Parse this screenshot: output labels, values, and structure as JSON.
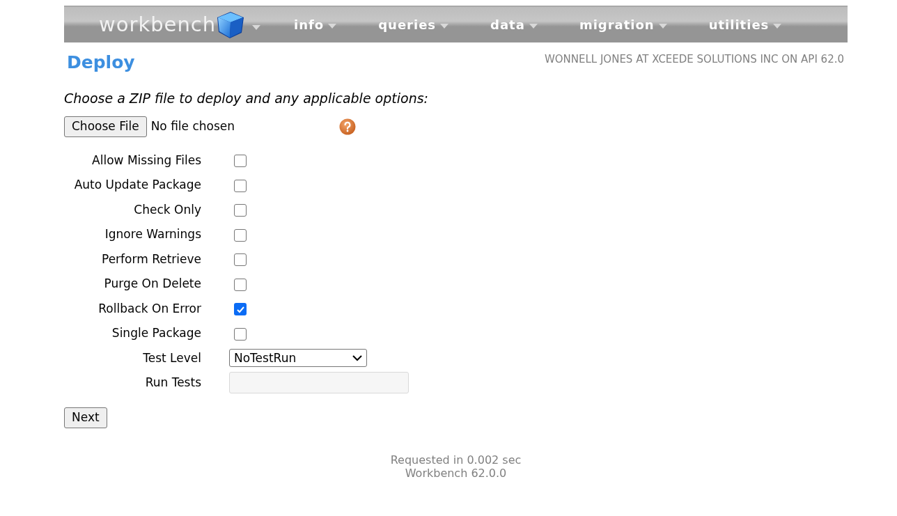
{
  "nav": {
    "logo": "workbench",
    "menus": [
      {
        "label": "info"
      },
      {
        "label": "queries"
      },
      {
        "label": "data"
      },
      {
        "label": "migration"
      },
      {
        "label": "utilities"
      }
    ]
  },
  "page": {
    "title": "Deploy",
    "user_info": "WONNELL JONES AT XCEEDE SOLUTIONS INC ON API 62.0"
  },
  "form": {
    "instruction": "Choose a ZIP file to deploy and any applicable options:",
    "file_button": "Choose File",
    "file_status": "No file chosen",
    "options": [
      {
        "kind": "checkbox",
        "label": "Allow Missing Files",
        "checked": false
      },
      {
        "kind": "checkbox",
        "label": "Auto Update Package",
        "checked": false
      },
      {
        "kind": "checkbox",
        "label": "Check Only",
        "checked": false
      },
      {
        "kind": "checkbox",
        "label": "Ignore Warnings",
        "checked": false
      },
      {
        "kind": "checkbox",
        "label": "Perform Retrieve",
        "checked": false
      },
      {
        "kind": "checkbox",
        "label": "Purge On Delete",
        "checked": false
      },
      {
        "kind": "checkbox",
        "label": "Rollback On Error",
        "checked": true
      },
      {
        "kind": "checkbox",
        "label": "Single Package",
        "checked": false
      },
      {
        "kind": "select",
        "label": "Test Level",
        "value": "NoTestRun"
      },
      {
        "kind": "text",
        "label": "Run Tests",
        "disabled": true
      }
    ],
    "submit": "Next"
  },
  "footer": {
    "lines": [
      "Requested in 0.002 sec",
      "Workbench 62.0.0"
    ]
  }
}
